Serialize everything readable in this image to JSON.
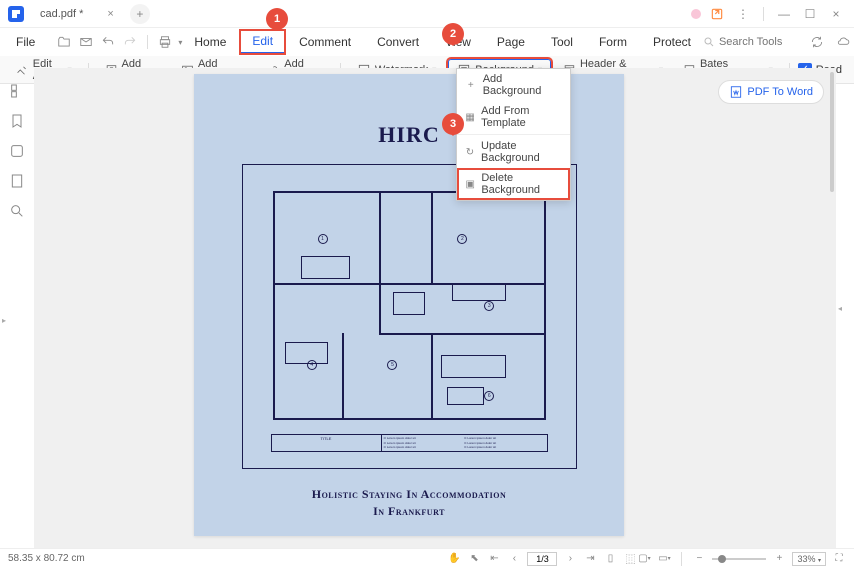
{
  "title_bar": {
    "tab_name": "cad.pdf *"
  },
  "menu": {
    "file": "File",
    "tabs": [
      "Home",
      "Edit",
      "Comment",
      "Convert",
      "View",
      "Page",
      "Tool",
      "Form",
      "Protect"
    ],
    "active_tab": "Edit",
    "search_placeholder": "Search Tools"
  },
  "toolbar": {
    "edit_all": "Edit All",
    "add_text": "Add Text",
    "add_image": "Add Image",
    "add_link": "Add Link",
    "watermark": "Watermark",
    "background": "Background",
    "header_footer": "Header & Footer",
    "bates_number": "Bates Number",
    "read": "Read"
  },
  "callouts": {
    "one": "1",
    "two": "2",
    "three": "3"
  },
  "dropdown": {
    "add_bg": "Add Background",
    "add_template": "Add From Template",
    "update_bg": "Update Background",
    "delete_bg": "Delete Background"
  },
  "page": {
    "title": "HIRC",
    "subtitle": "Holistic Staying In Accommodation",
    "subtitle2": "In Frankfurt",
    "title_block": "TITLE"
  },
  "pdf_word": "PDF To Word",
  "status": {
    "dims": "58.35 x 80.72 cm",
    "page": "1/3",
    "zoom": "33%"
  }
}
